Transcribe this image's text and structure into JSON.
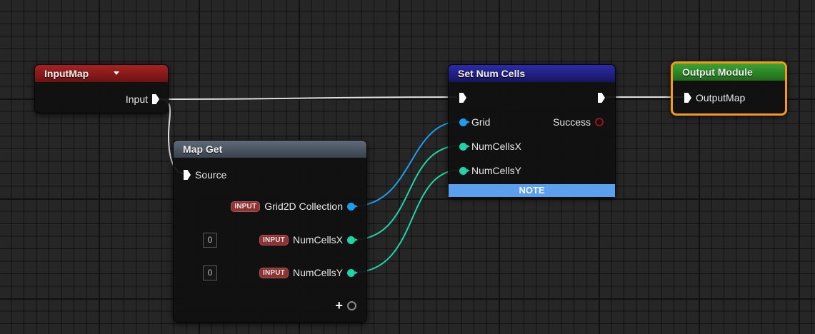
{
  "nodes": {
    "input_map": {
      "title": "InputMap",
      "pin_input": "Input",
      "header_color": "#8b1c1c"
    },
    "map_get": {
      "title": "Map Get",
      "pin_source": "Source",
      "badge": "INPUT",
      "pins": [
        {
          "label": "Grid2D Collection"
        },
        {
          "label": "NumCellsX",
          "value": "0"
        },
        {
          "label": "NumCellsY",
          "value": "0"
        }
      ],
      "add_label": "+",
      "header_color": "#4a5360"
    },
    "set_num_cells": {
      "title": "Set Num Cells",
      "pin_grid": "Grid",
      "pin_numcellsx": "NumCellsX",
      "pin_numcellsy": "NumCellsY",
      "pin_success": "Success",
      "note": "NOTE",
      "header_color": "#23228a"
    },
    "output_module": {
      "title": "Output Module",
      "pin_outputmap": "OutputMap",
      "header_color": "#2f8a2a",
      "border_color": "#f29a1a"
    }
  },
  "colors": {
    "exec_wire": "#dedede",
    "grid_pin": "#1e9ee8",
    "int_pin": "#21d4a6",
    "bool_pin": "#9a1313"
  }
}
